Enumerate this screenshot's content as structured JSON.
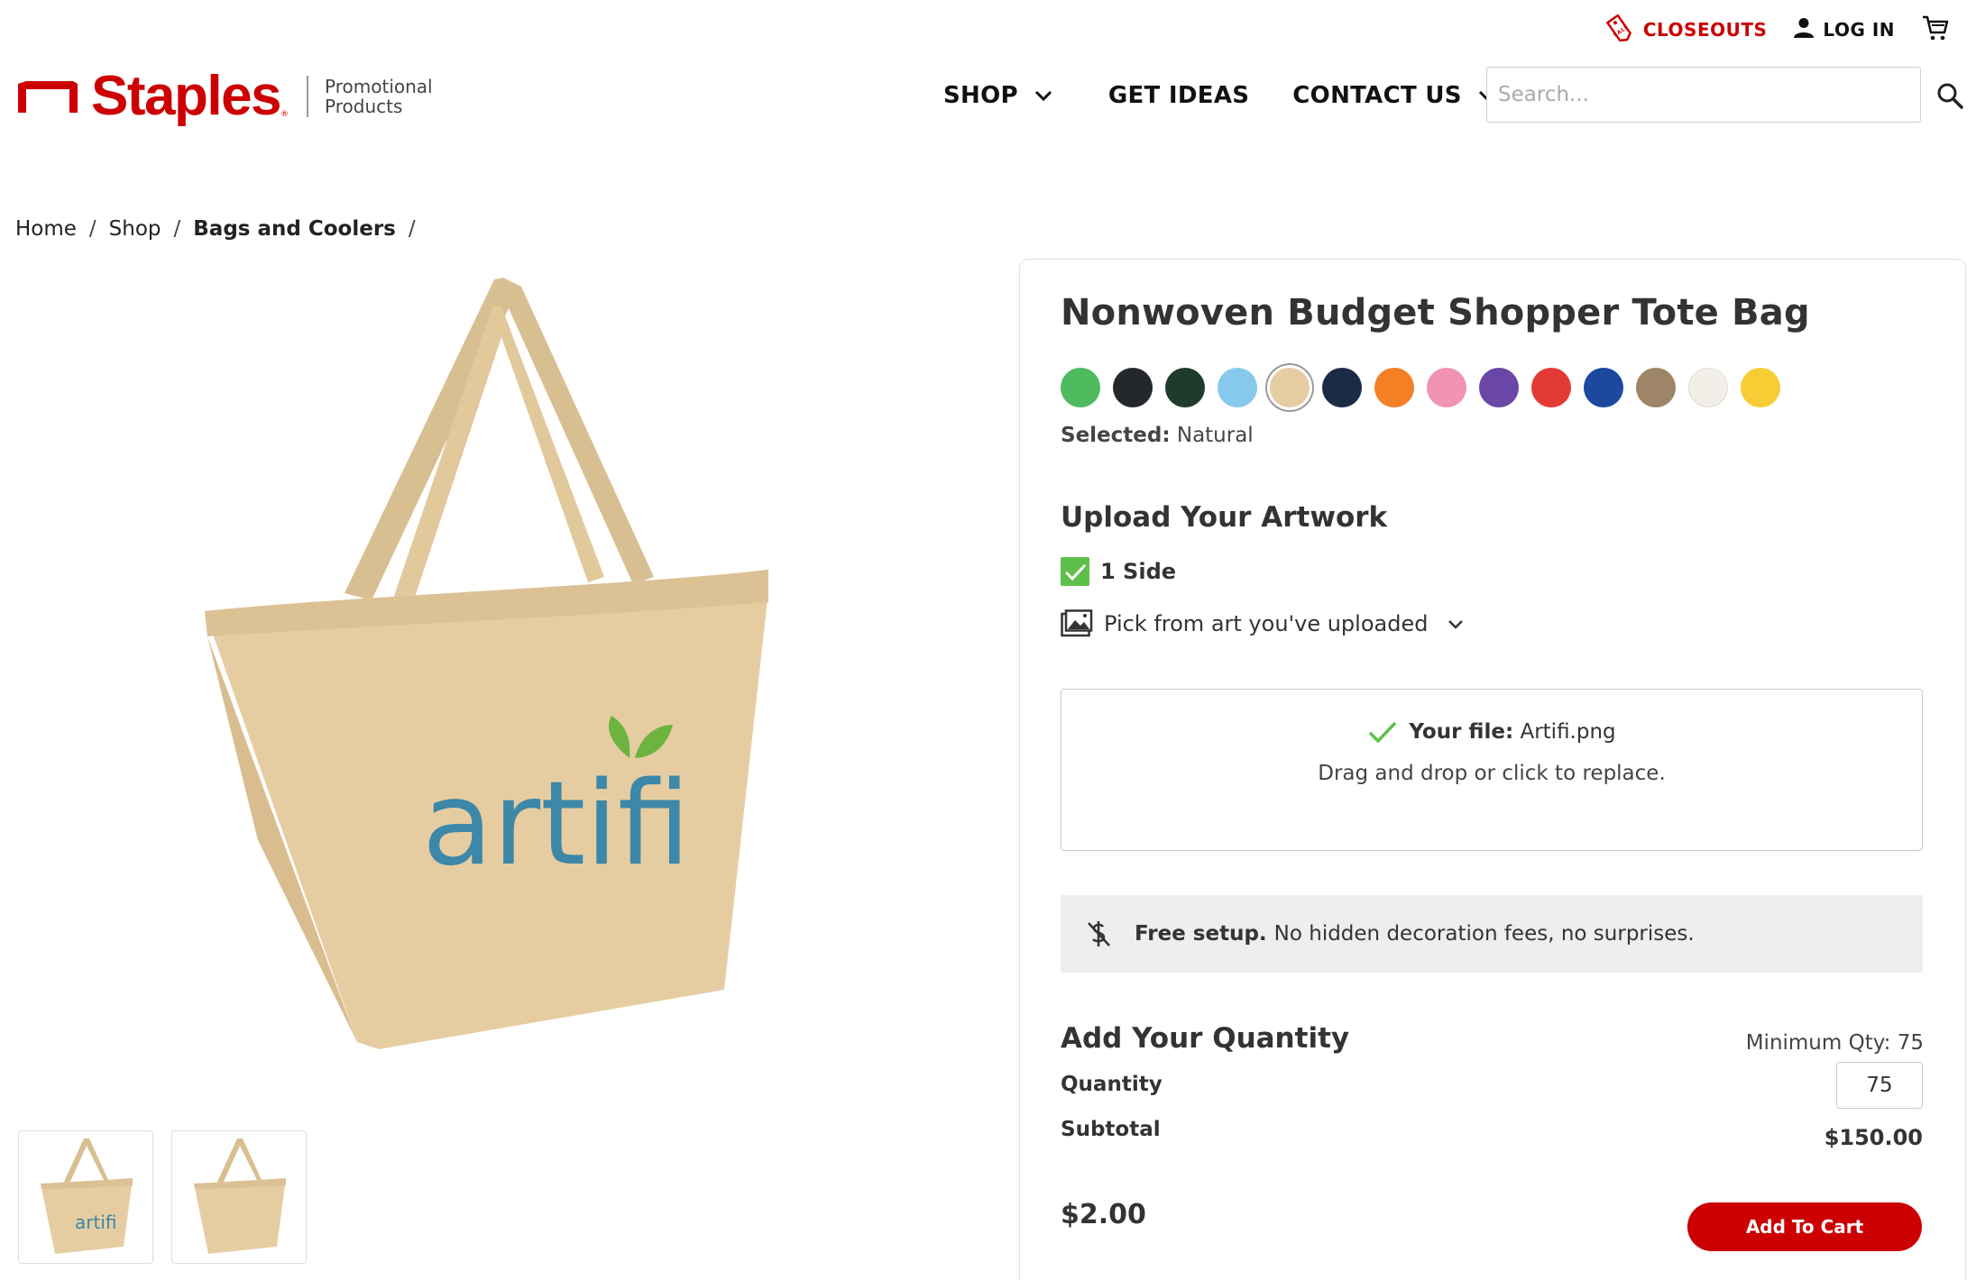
{
  "header": {
    "closeouts_label": "CLOSEOUTS",
    "login_label": "LOG IN",
    "brand_name": "Staples",
    "brand_tm": "®",
    "brand_sub_line1": "Promotional",
    "brand_sub_line2": "Products",
    "nav": {
      "shop": "SHOP",
      "get_ideas": "GET IDEAS",
      "contact_us": "CONTACT US"
    },
    "search_placeholder": "Search..."
  },
  "breadcrumb": {
    "home": "Home",
    "shop": "Shop",
    "category": "Bags and Coolers",
    "sep": "/"
  },
  "product": {
    "title": "Nonwoven Budget Shopper Tote Bag",
    "print_logo_text": "artifi",
    "colors": [
      {
        "hex": "#4fba5e",
        "selected": false
      },
      {
        "hex": "#24282d",
        "selected": false
      },
      {
        "hex": "#1f3b2c",
        "selected": false
      },
      {
        "hex": "#87c9ec",
        "selected": false
      },
      {
        "hex": "#e6cda1",
        "selected": true
      },
      {
        "hex": "#1c2b45",
        "selected": false
      },
      {
        "hex": "#f57f25",
        "selected": false
      },
      {
        "hex": "#f193b2",
        "selected": false
      },
      {
        "hex": "#6a47a6",
        "selected": false
      },
      {
        "hex": "#e43a36",
        "selected": false
      },
      {
        "hex": "#1c48a0",
        "selected": false
      },
      {
        "hex": "#9e8567",
        "selected": false
      },
      {
        "hex": "#f2eee8",
        "selected": false
      },
      {
        "hex": "#f6cd34",
        "selected": false
      }
    ],
    "selected_label": "Selected:",
    "selected_value": "Natural"
  },
  "artwork": {
    "heading": "Upload Your Artwork",
    "side_label": "1 Side",
    "pick_label": "Pick from art you've uploaded",
    "file_label": "Your file:",
    "file_name": "Artifi.png",
    "drop_hint": "Drag and drop or click to replace."
  },
  "setup": {
    "bold": "Free setup.",
    "text": "No hidden decoration fees, no surprises."
  },
  "quantity": {
    "heading": "Add Your Quantity",
    "min_qty": "Minimum Qty: 75",
    "quantity_label": "Quantity",
    "quantity_value": "75",
    "subtotal_label": "Subtotal",
    "subtotal_value": "$150.00",
    "unit_price": "$2.00",
    "add_to_cart": "Add To Cart"
  },
  "colors": {
    "brand_red": "#cc0000",
    "bag_tan": "#e6cda1",
    "logo_blue": "#3d87a8",
    "logo_green": "#6cb33f"
  }
}
